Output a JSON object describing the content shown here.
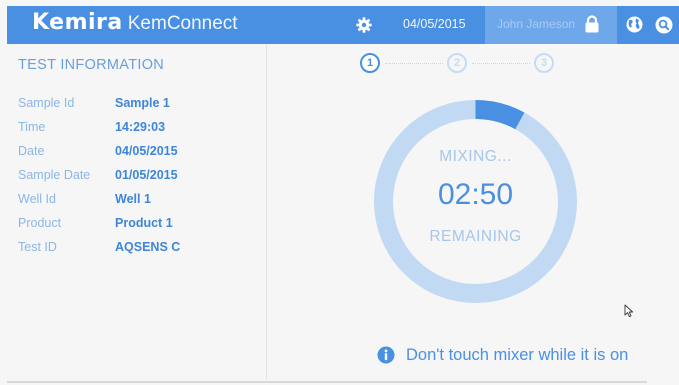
{
  "header": {
    "brand": "Kemira",
    "app_name": "KemConnect",
    "date": "04/05/2015",
    "user_name": "John Jameson",
    "icons": [
      "gear-icon",
      "lock-icon",
      "globe-icon",
      "search-icon"
    ]
  },
  "test_info": {
    "title": "TEST INFORMATION",
    "rows": [
      {
        "label": "Sample Id",
        "value": "Sample 1"
      },
      {
        "label": "Time",
        "value": "14:29:03"
      },
      {
        "label": "Date",
        "value": "04/05/2015"
      },
      {
        "label": "Sample Date",
        "value": "01/05/2015"
      },
      {
        "label": "Well Id",
        "value": "Well 1"
      },
      {
        "label": "Product",
        "value": "Product 1"
      },
      {
        "label": "Test ID",
        "value": "AQSENS C"
      }
    ]
  },
  "steps": {
    "items": [
      "1",
      "2",
      "3"
    ],
    "current": 1
  },
  "mixing": {
    "status": "MIXING...",
    "time_left": "02:50",
    "remaining_label": "REMAINING",
    "progress_fraction": 0.08
  },
  "notice": {
    "text": "Don't touch mixer while it is on",
    "icon": "info-icon"
  },
  "colors": {
    "accent": "#4a90e2",
    "ring_track": "#c1d9f3",
    "label": "#8cb6e6",
    "value": "#3d86d8"
  }
}
